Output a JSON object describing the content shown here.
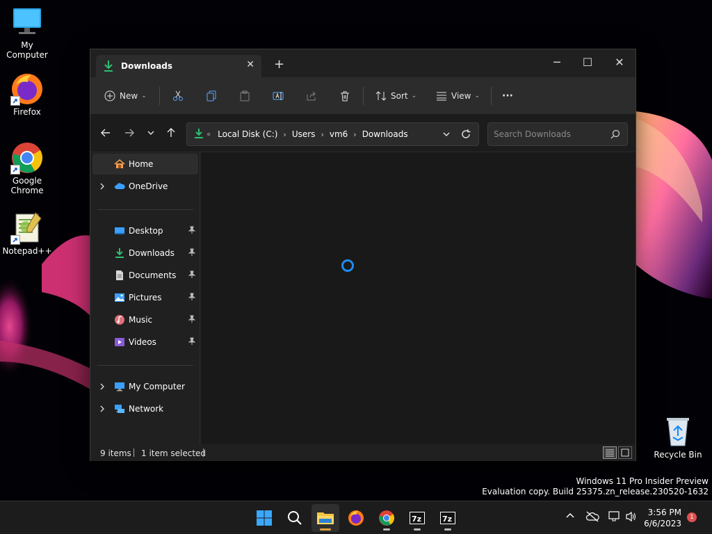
{
  "desktop": {
    "icons": [
      {
        "label": "My Computer"
      },
      {
        "label": "Firefox"
      },
      {
        "label": "Google Chrome"
      },
      {
        "label": "Notepad++"
      },
      {
        "label": "Recycle Bin"
      }
    ]
  },
  "explorer": {
    "tab": {
      "title": "Downloads",
      "icon": "download-icon"
    },
    "commandbar": {
      "new_label": "New",
      "sort_label": "Sort",
      "view_label": "View",
      "more_label": "···"
    },
    "address": {
      "crumbs": [
        "Local Disk (C:)",
        "Users",
        "vm6",
        "Downloads"
      ],
      "overflow_label": "«"
    },
    "search": {
      "placeholder": "Search Downloads"
    },
    "sidebar": {
      "items": [
        {
          "label": "Home",
          "icon": "home-icon"
        },
        {
          "label": "OneDrive",
          "icon": "cloud-icon"
        },
        {
          "label": "Desktop",
          "icon": "desktop-icon"
        },
        {
          "label": "Downloads",
          "icon": "download-icon"
        },
        {
          "label": "Documents",
          "icon": "document-icon"
        },
        {
          "label": "Pictures",
          "icon": "picture-icon"
        },
        {
          "label": "Music",
          "icon": "music-icon"
        },
        {
          "label": "Videos",
          "icon": "video-icon"
        },
        {
          "label": "My Computer",
          "icon": "computer-icon"
        },
        {
          "label": "Network",
          "icon": "network-icon"
        }
      ]
    },
    "status": {
      "items_count": "9 items",
      "selection": "1 item selected"
    }
  },
  "watermark": {
    "line1": "Windows 11 Pro Insider Preview",
    "line2": "Evaluation copy. Build 25375.zn_release.230520-1632"
  },
  "taskbar": {
    "clock_time": "3:56 PM",
    "clock_date": "6/6/2023",
    "notification_count": "1"
  },
  "colors": {
    "accent": "#1e8cf0",
    "download_green": "#2fbf71",
    "folder_yellow": "#f4c542"
  }
}
